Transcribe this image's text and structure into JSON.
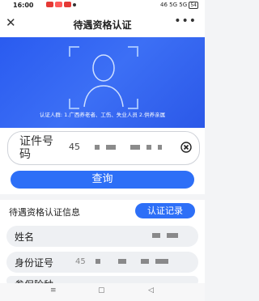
{
  "status_bar": {
    "time": "16:00",
    "signal": "46 5G 5G",
    "battery": "54"
  },
  "header": {
    "title": "待遇资格认证",
    "close_icon": "close-icon",
    "more_icon": "more-icon"
  },
  "banner": {
    "caption": "认证人群: 1.广西养老者、工伤、失业人员    2.供养亲属"
  },
  "id_input": {
    "label": "证件号码",
    "value": "45"
  },
  "query_button": "查询",
  "info": {
    "heading": "待遇资格认证信息",
    "record_button": "认证记录",
    "fields": [
      {
        "label": "姓名",
        "value": ""
      },
      {
        "label": "身份证号",
        "value": "45"
      },
      {
        "label": "参保险种",
        "value": ""
      }
    ]
  },
  "navbar": {
    "menu": "≡",
    "home": "▢",
    "back": "◁"
  }
}
